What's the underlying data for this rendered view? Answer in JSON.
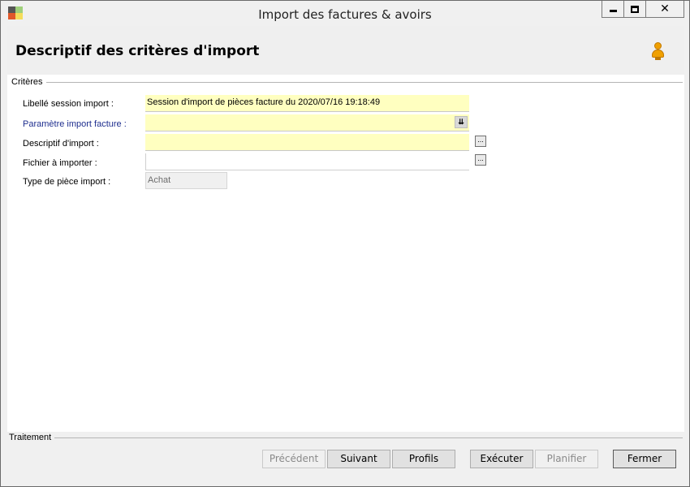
{
  "window": {
    "title": "Import des factures & avoirs"
  },
  "header": {
    "title": "Descriptif des critères d'import"
  },
  "criteria": {
    "group_label": "Critères",
    "fields": [
      {
        "label": "Libellé session import :",
        "value": "Session d'import de pièces facture du 2020/07/16 19:18:49"
      },
      {
        "label": "Paramètre import facture :",
        "value": ""
      },
      {
        "label": "Descriptif d'import :",
        "value": ""
      },
      {
        "label": "Fichier à importer :",
        "value": ""
      },
      {
        "label": "Type de pièce import :",
        "value": "Achat"
      }
    ]
  },
  "treatment": {
    "group_label": "Traitement",
    "buttons": {
      "previous": "Précédent",
      "next": "Suivant",
      "profiles": "Profils",
      "execute": "Exécuter",
      "schedule": "Planifier",
      "close": "Fermer"
    }
  },
  "colors": {
    "required_field_bg": "#ffffc0",
    "link_label": "#1f2f8f"
  }
}
